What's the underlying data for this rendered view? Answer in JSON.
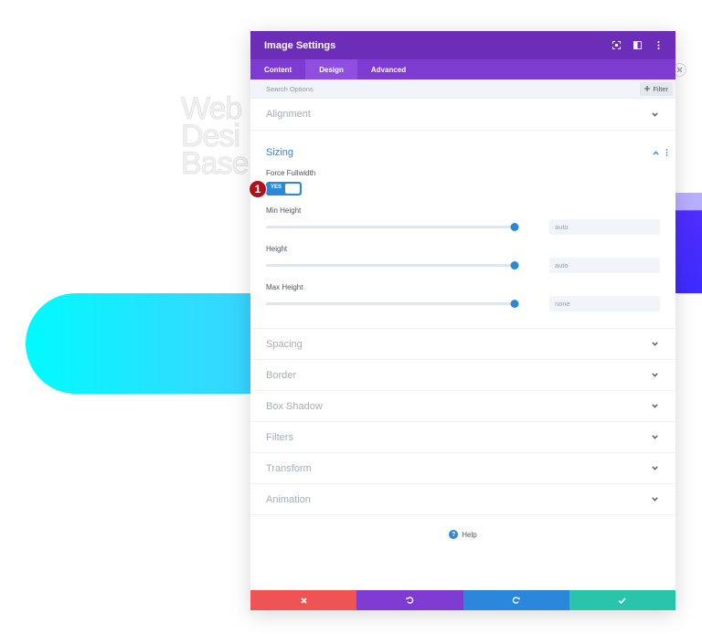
{
  "background": {
    "ghost_lines": [
      "Web",
      "Desi",
      "Base"
    ]
  },
  "modal": {
    "title": "Image Settings",
    "tabs": [
      {
        "label": "Content"
      },
      {
        "label": "Design"
      },
      {
        "label": "Advanced"
      }
    ],
    "active_tab": "Design",
    "search": {
      "placeholder": "Search Options",
      "value": ""
    },
    "filter_label": "Filter",
    "sections_top": [
      {
        "title": "Alignment"
      }
    ],
    "sizing": {
      "title": "Sizing",
      "force_fullwidth": {
        "label": "Force Fullwidth",
        "value": "YES"
      },
      "sliders": [
        {
          "label": "Min Height",
          "value": "auto",
          "level": 1.0
        },
        {
          "label": "Height",
          "value": "auto",
          "level": 1.0
        },
        {
          "label": "Max Height",
          "value": "none",
          "level": 1.0
        }
      ]
    },
    "sections_bottom": [
      {
        "title": "Spacing"
      },
      {
        "title": "Border"
      },
      {
        "title": "Box Shadow"
      },
      {
        "title": "Filters"
      },
      {
        "title": "Transform"
      },
      {
        "title": "Animation"
      }
    ],
    "help_label": "Help",
    "footer": {
      "cancel_icon": "close-icon",
      "undo_icon": "undo-icon",
      "redo_icon": "redo-icon",
      "save_icon": "check-icon"
    }
  },
  "annotation": {
    "step_number": "1"
  },
  "colors": {
    "header": "#6c2eb9",
    "tabs": "#7e3bd0",
    "active_tab": "#8f4ee0",
    "accent": "#2b87da",
    "cancel": "#ef5454",
    "undo": "#7d3bcf",
    "redo": "#2b87da",
    "save": "#29c4a9",
    "badge": "#b0121c"
  }
}
